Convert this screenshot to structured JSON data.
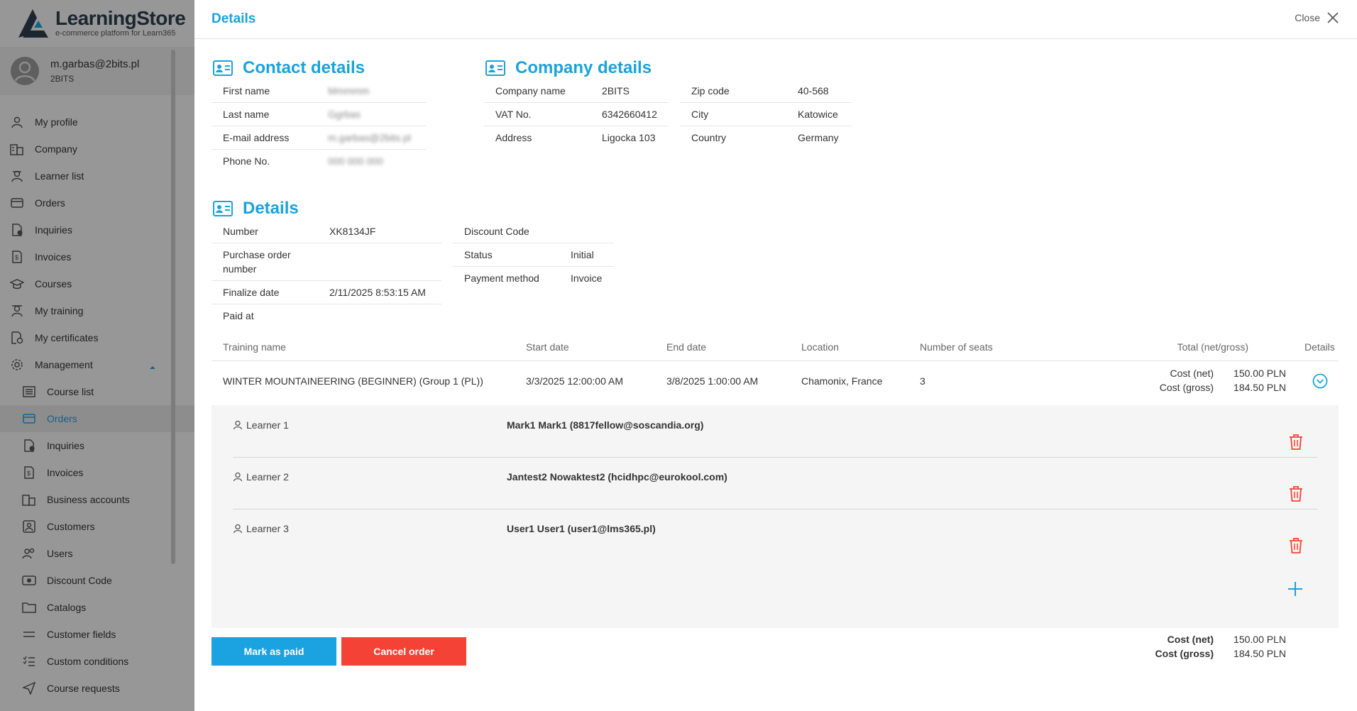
{
  "brand": {
    "title": "LearningStore",
    "subtitle": "e-commerce platform for Learn365"
  },
  "user": {
    "email": "m.garbas@2bits.pl",
    "company": "2BITS"
  },
  "nav": [
    {
      "label": "My profile",
      "icon": "user-icon"
    },
    {
      "label": "Company",
      "icon": "building-icon"
    },
    {
      "label": "Learner list",
      "icon": "learner-icon"
    },
    {
      "label": "Orders",
      "icon": "wallet-icon"
    },
    {
      "label": "Inquiries",
      "icon": "inquiry-icon"
    },
    {
      "label": "Invoices",
      "icon": "invoice-icon"
    },
    {
      "label": "Courses",
      "icon": "graduation-cap-icon"
    },
    {
      "label": "My training",
      "icon": "training-icon"
    },
    {
      "label": "My certificates",
      "icon": "certificate-icon"
    },
    {
      "label": "Management",
      "icon": "gear-icon"
    },
    {
      "label": "Course list",
      "icon": "list-icon"
    },
    {
      "label": "Orders",
      "icon": "wallet-icon"
    },
    {
      "label": "Inquiries",
      "icon": "inquiry-icon"
    },
    {
      "label": "Invoices",
      "icon": "invoice-icon"
    },
    {
      "label": "Business accounts",
      "icon": "building-icon"
    },
    {
      "label": "Customers",
      "icon": "customer-icon"
    },
    {
      "label": "Users",
      "icon": "users-icon"
    },
    {
      "label": "Discount Code",
      "icon": "discount-icon"
    },
    {
      "label": "Catalogs",
      "icon": "folder-icon"
    },
    {
      "label": "Customer fields",
      "icon": "equals-icon"
    },
    {
      "label": "Custom conditions",
      "icon": "checklist-icon"
    },
    {
      "label": "Course requests",
      "icon": "send-icon"
    }
  ],
  "panel": {
    "title": "Details",
    "close_label": "Close"
  },
  "contact": {
    "title": "Contact details",
    "rows": [
      {
        "key": "First name",
        "value": "Mmmmm"
      },
      {
        "key": "Last name",
        "value": "Ggrbas"
      },
      {
        "key": "E-mail address",
        "value": "m.garbas@2bits.pl"
      },
      {
        "key": "Phone No.",
        "value": "000 000 000"
      }
    ]
  },
  "company": {
    "title": "Company details",
    "left": [
      {
        "key": "Company name",
        "value": "2BITS"
      },
      {
        "key": "VAT No.",
        "value": "6342660412"
      },
      {
        "key": "Address",
        "value": "Ligocka 103"
      }
    ],
    "right": [
      {
        "key": "Zip code",
        "value": "40-568"
      },
      {
        "key": "City",
        "value": "Katowice"
      },
      {
        "key": "Country",
        "value": "Germany"
      }
    ]
  },
  "details": {
    "title": "Details",
    "left": [
      {
        "key": "Number",
        "value": "XK8134JF"
      },
      {
        "key": "Purchase order number",
        "value": ""
      },
      {
        "key": "Finalize date",
        "value": "2/11/2025 8:53:15 AM"
      },
      {
        "key": "Paid at",
        "value": ""
      }
    ],
    "right": [
      {
        "key": "Discount Code",
        "value": ""
      },
      {
        "key": "Status",
        "value": "Initial"
      },
      {
        "key": "Payment method",
        "value": "Invoice"
      }
    ]
  },
  "table": {
    "headers": {
      "training": "Training name",
      "start": "Start date",
      "end": "End date",
      "location": "Location",
      "seats": "Number of seats",
      "total": "Total (net/gross)",
      "details": "Details"
    },
    "row": {
      "training": "WINTER MOUNTAINEERING (BEGINNER) (Group 1 (PL))",
      "start": "3/3/2025 12:00:00 AM",
      "end": "3/8/2025 1:00:00 AM",
      "location": "Chamonix, France",
      "seats": "3",
      "net_label": "Cost (net)",
      "net_value": "150.00 PLN",
      "gross_label": "Cost (gross)",
      "gross_value": "184.50 PLN"
    }
  },
  "learners": [
    {
      "label": "Learner 1",
      "value": "Mark1 Mark1 (8817fellow@soscandia.org)"
    },
    {
      "label": "Learner 2",
      "value": "Jantest2 Nowaktest2 (hcidhpc@eurokool.com)"
    },
    {
      "label": "Learner 3",
      "value": "User1 User1 (user1@lms365.pl)"
    }
  ],
  "actions": {
    "mark_paid": "Mark as paid",
    "cancel": "Cancel order"
  },
  "totals": {
    "net_label": "Cost (net)",
    "net_value": "150.00 PLN",
    "gross_label": "Cost (gross)",
    "gross_value": "184.50 PLN"
  },
  "colors": {
    "accent": "#1aa3d9",
    "danger": "#f44336",
    "sidebar": "#f4f4f4"
  }
}
